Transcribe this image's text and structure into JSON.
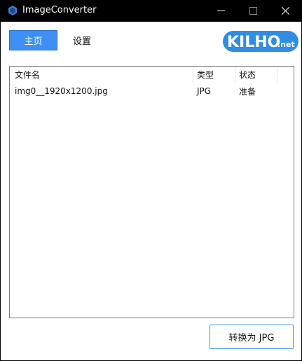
{
  "window": {
    "title": "ImageConverter",
    "buttons": {
      "minimize_icon": "minimize-icon",
      "maximize_icon": "maximize-icon",
      "close_icon": "close-icon"
    }
  },
  "nav": {
    "tabs": [
      {
        "label": "主页",
        "active": true
      },
      {
        "label": "设置",
        "active": false
      }
    ]
  },
  "logo": {
    "text_main": "KILHO",
    "text_suffix": ".net"
  },
  "file_list": {
    "columns": [
      "文件名",
      "类型",
      "状态"
    ],
    "rows": [
      {
        "name": "img0__1920x1200.jpg",
        "type": "JPG",
        "status": "准备"
      }
    ]
  },
  "actions": {
    "convert_label": "转换为 JPG"
  },
  "colors": {
    "accent": "#3d8ff3",
    "titlebar": "#000000",
    "logo": "#2f8de4"
  }
}
